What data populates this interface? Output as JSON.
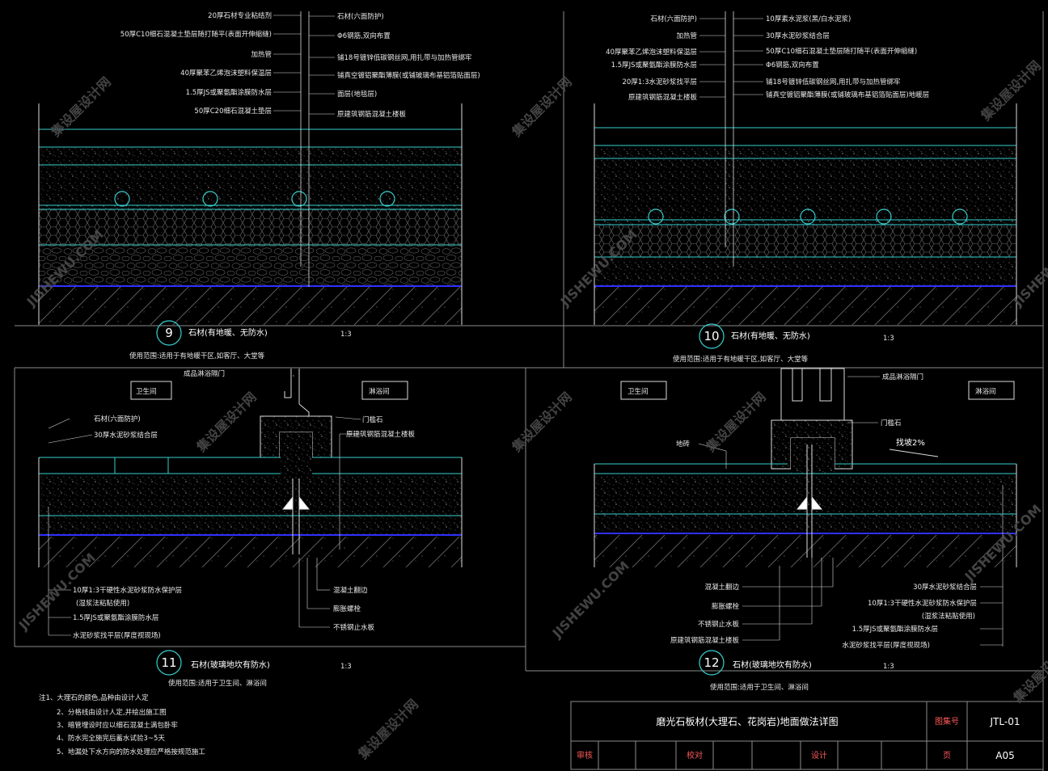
{
  "colors": {
    "background": "#000000",
    "frame": "#8c8c8c",
    "cyan": "#39d0d0",
    "blue": "#3030ff",
    "white_text": "#ffffff",
    "red_text": "#ff5050",
    "yellow_text": "#ffff66",
    "watermark": "#4b4b4b"
  },
  "watermark": {
    "cn": "集设屋设计网",
    "url": "JISHEWU.COM"
  },
  "detail9": {
    "labels_left": [
      "20厚石材专业粘结剂",
      "50厚C10细石混凝土垫层随打随平(表面开伸缩缝)",
      "加热管",
      "40厚聚苯乙烯泡沫塑料保温层",
      "1.5厚JS或聚氨酯涂膜防水层",
      "50厚C20细石混凝土垫层"
    ],
    "labels_right": [
      "石材(六面防护)",
      "Φ6钢筋,双向布置",
      "铺18号镀锌低碳钢丝网,用扎带与加热管绑牢",
      "铺真空镀铝聚酯薄膜(或铺玻璃布基铝箔贴面层)",
      "面层(地毯层)",
      "原建筑钢筋混凝土楼板"
    ],
    "number": "9",
    "title": "石材(有地暖、无防水)",
    "scale": "1:3",
    "scope": "使用范围:适用于有地暖干区,如客厅、大堂等"
  },
  "detail10": {
    "labels_left": [
      "石材(六面防护)",
      "加热管",
      "40厚聚苯乙烯泡沫塑料保温层",
      "1.5厚JS或聚氨酯涂膜防水层",
      "20厚1:3水泥砂浆找平层",
      "原建筑钢筋混凝土楼板"
    ],
    "labels_right": [
      "10厚素水泥浆(黑/白水泥浆)",
      "30厚水泥砂浆结合层",
      "50厚C10细石混凝土垫层随打随平(表面开伸缩缝)",
      "Φ6钢筋,双向布置",
      "铺18号镀锌低碳钢丝网,用扎带与加热管绑牢",
      "铺真空镀铝聚酯薄膜(或铺玻璃布基铝箔贴面层)地暖层"
    ],
    "number": "10",
    "title": "石材(有地暖、无防水)",
    "scale": "1:3",
    "scope": "使用范围:适用于有地暖干区,如客厅、大堂等"
  },
  "detail11": {
    "room_left": "卫生间",
    "room_right": "淋浴间",
    "door": "成品淋浴隔门",
    "threshold": "门槛石",
    "labels_left_top": [
      "石材(六面防护)",
      "30厚水泥砂浆结合层"
    ],
    "slab": "原建筑钢筋混凝土楼板",
    "labels_left_bottom": [
      "10厚1:3干硬性水泥砂浆防水保护层",
      "(湿浆法粘贴使用)",
      "1.5厚JS或聚氨酯涂膜防水层",
      "水泥砂浆找平层(厚度视现场)"
    ],
    "labels_mid_bottom": [
      "混凝土翻边",
      "膨胀螺栓",
      "不锈钢止水板"
    ],
    "number": "11",
    "title": "石材(玻璃地坎有防水)",
    "scale": "1:3",
    "scope": "使用范围:适用于卫生间、淋浴间"
  },
  "detail12": {
    "room_left": "卫生间",
    "room_right": "淋浴间",
    "door": "成品淋浴隔门",
    "threshold": "门槛石",
    "floor_drain": "地砖",
    "slope": "找坡2%",
    "labels_left_bottom": [
      "混凝土翻边",
      "膨胀螺栓",
      "不锈钢止水板",
      "原建筑钢筋混凝土楼板"
    ],
    "labels_right_bottom": [
      "30厚水泥砂浆结合层",
      "10厚1:3干硬性水泥砂浆防水保护层",
      "(湿浆法粘贴使用)",
      "1.5厚JS或聚氨酯涂膜防水层",
      "水泥砂浆找平层(厚度视现场)"
    ],
    "number": "12",
    "title": "石材(玻璃地坎有防水)",
    "scale": "1:3",
    "scope": "使用范围:适用于卫生间、淋浴间"
  },
  "notes": [
    "注1、大理石的颜色,品种由设计人定",
    "2、分格线由设计人定,并绘出施工图",
    "3、暗管埋设时应以细石混凝土满包卧牢",
    "4、防水完全施完后蓄水试验3~5天",
    "5、地漏处下水方向的防水处理应严格按规范施工"
  ],
  "title_block": {
    "title": "磨光石板材(大理石、花岗岩)地面做法详图",
    "drawing_no_label": "图集号",
    "drawing_no": "JTL-01",
    "review": "审核",
    "check": "校对",
    "design": "设计",
    "page_label": "页",
    "page": "A05"
  }
}
